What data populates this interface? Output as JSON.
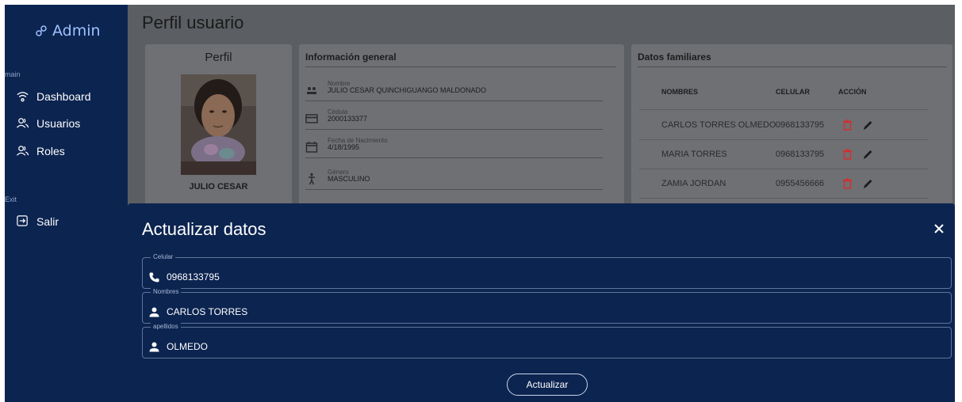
{
  "sidebar": {
    "brand": "Admin",
    "section_main": "main",
    "section_exit": "Exit",
    "items": [
      {
        "label": "Dashboard",
        "icon": "wifi-icon"
      },
      {
        "label": "Usuarios",
        "icon": "users-icon"
      },
      {
        "label": "Roles",
        "icon": "users-icon"
      }
    ],
    "exit_item": {
      "label": "Salir",
      "icon": "logout-icon"
    }
  },
  "page": {
    "title": "Perfil usuario"
  },
  "profile": {
    "title": "Perfil",
    "name": "JULIO CESAR"
  },
  "general_info": {
    "title": "Información general",
    "rows": [
      {
        "label": "Nombre",
        "value": "JULIO CESAR QUINCHIGUANGO MALDONADO",
        "icon": "people-icon"
      },
      {
        "label": "Cédula",
        "value": "2000133377",
        "icon": "id-card-icon"
      },
      {
        "label": "Fecha de Nacimiento",
        "value": "4/18/1995",
        "icon": "calendar-icon"
      },
      {
        "label": "Género",
        "value": "MASCULINO",
        "icon": "person-gender-icon"
      }
    ]
  },
  "family": {
    "title": "Datos familiares",
    "headers": {
      "names": "NOMBRES",
      "phone": "CELULAR",
      "action": "ACCIÓN"
    },
    "rows": [
      {
        "name": "CARLOS TORRES OLMEDO",
        "phone": "0968133795"
      },
      {
        "name": "MARIA TORRES",
        "phone": "0968133795"
      },
      {
        "name": "ZAMIA JORDAN",
        "phone": "0955456666"
      }
    ]
  },
  "modal": {
    "title": "Actualizar datos",
    "fields": [
      {
        "legend": "Celular",
        "value": "0968133795",
        "icon": "phone-icon"
      },
      {
        "legend": "Nombres",
        "value": "CARLOS TORRES",
        "icon": "person-icon"
      },
      {
        "legend": "apellidos",
        "value": "OLMEDO",
        "icon": "person-icon"
      }
    ],
    "submit_label": "Actualizar"
  },
  "colors": {
    "sidebar_bg": "#0c2450",
    "overlay_bg": "#5b5e62",
    "delete": "#d32f2f"
  }
}
